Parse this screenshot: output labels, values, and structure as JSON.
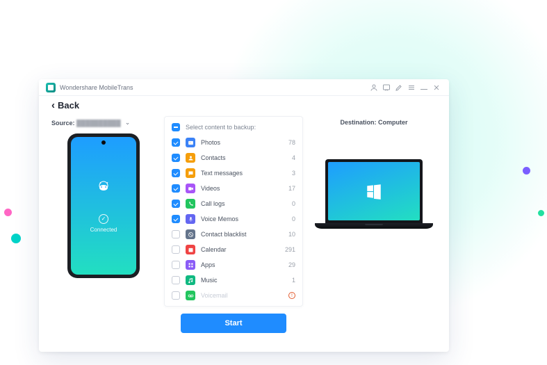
{
  "window": {
    "title": "Wondershare MobileTrans"
  },
  "header": {
    "back": "Back"
  },
  "source": {
    "label": "Source:",
    "device": "██████████",
    "status": "Connected"
  },
  "destination": {
    "label": "Destination:",
    "device": "Computer"
  },
  "list": {
    "select_all_label": "Select content to backup:",
    "items": [
      {
        "name": "Photos",
        "count": 78,
        "checked": true,
        "icon": "photos",
        "color": "#3b82f6"
      },
      {
        "name": "Contacts",
        "count": 4,
        "checked": true,
        "icon": "contacts",
        "color": "#f59e0b"
      },
      {
        "name": "Text messages",
        "count": 3,
        "checked": true,
        "icon": "sms",
        "color": "#f59e0b"
      },
      {
        "name": "Videos",
        "count": 17,
        "checked": true,
        "icon": "videos",
        "color": "#a855f7"
      },
      {
        "name": "Call logs",
        "count": 0,
        "checked": true,
        "icon": "calls",
        "color": "#22c55e"
      },
      {
        "name": "Voice Memos",
        "count": 0,
        "checked": true,
        "icon": "voice",
        "color": "#6366f1"
      },
      {
        "name": "Contact blacklist",
        "count": 10,
        "checked": false,
        "icon": "block",
        "color": "#64748b"
      },
      {
        "name": "Calendar",
        "count": 291,
        "checked": false,
        "icon": "calendar",
        "color": "#ef4444"
      },
      {
        "name": "Apps",
        "count": 29,
        "checked": false,
        "icon": "apps",
        "color": "#8b5cf6"
      },
      {
        "name": "Music",
        "count": 1,
        "checked": false,
        "icon": "music",
        "color": "#10b981"
      },
      {
        "name": "Voicemail",
        "count": "",
        "checked": false,
        "icon": "vm",
        "color": "#22c55e",
        "disabled": true,
        "warn": true
      }
    ]
  },
  "actions": {
    "start": "Start"
  }
}
